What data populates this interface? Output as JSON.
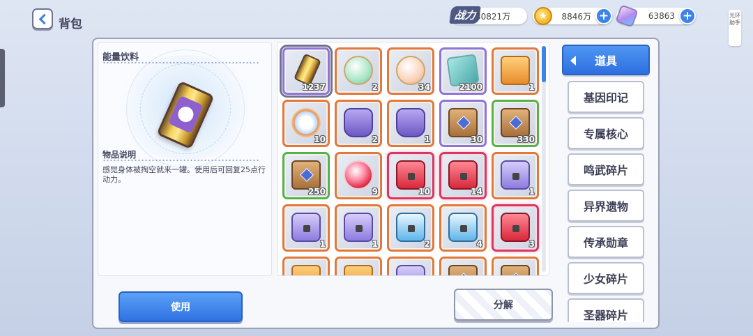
{
  "header": {
    "title": "背包",
    "helper_label": "光环助手"
  },
  "resources": {
    "power_label": "战力",
    "power_value": "30821万",
    "coins": "8846万",
    "gems": "63863"
  },
  "detail": {
    "item_name": "能量饮料",
    "desc_title": "物品说明",
    "desc_text": "感觉身体被掏空就来一罐。使用后可回复25点行动力。"
  },
  "grid": {
    "items": [
      {
        "count": "1237",
        "art": "can",
        "frame": "purple",
        "selected": true
      },
      {
        "count": "2",
        "art": "orb",
        "frame": "orange"
      },
      {
        "count": "34",
        "art": "orb2",
        "frame": "orange"
      },
      {
        "count": "2100",
        "art": "teal",
        "frame": "purple"
      },
      {
        "count": "1",
        "art": "box-gold",
        "frame": "orange"
      },
      {
        "count": "10",
        "art": "ring-orb",
        "frame": "orange"
      },
      {
        "count": "2",
        "art": "drum",
        "frame": "orange"
      },
      {
        "count": "1",
        "art": "drum",
        "frame": "orange"
      },
      {
        "count": "30",
        "art": "chest",
        "frame": "purple"
      },
      {
        "count": "330",
        "art": "chest",
        "frame": "green"
      },
      {
        "count": "250",
        "art": "chest",
        "frame": "green"
      },
      {
        "count": "9",
        "art": "redorb",
        "frame": "orange"
      },
      {
        "count": "10",
        "art": "box-red",
        "frame": "red"
      },
      {
        "count": "14",
        "art": "box-red",
        "frame": "red"
      },
      {
        "count": "1",
        "art": "box-purple",
        "frame": "orange"
      },
      {
        "count": "1",
        "art": "box-purple",
        "frame": "orange"
      },
      {
        "count": "1",
        "art": "box-purple",
        "frame": "orange"
      },
      {
        "count": "2",
        "art": "box-blue",
        "frame": "orange"
      },
      {
        "count": "4",
        "art": "box-blue",
        "frame": "orange"
      },
      {
        "count": "3",
        "art": "box-red",
        "frame": "red"
      },
      {
        "count": "",
        "art": "box-gold",
        "frame": "orange"
      },
      {
        "count": "",
        "art": "box-gold",
        "frame": "orange"
      },
      {
        "count": "",
        "art": "box-purple",
        "frame": "orange"
      },
      {
        "count": "",
        "art": "chest",
        "frame": "orange"
      },
      {
        "count": "",
        "art": "chest",
        "frame": "orange"
      }
    ]
  },
  "tabs": [
    {
      "label": "道具",
      "active": true
    },
    {
      "label": "基因印记"
    },
    {
      "label": "专属核心"
    },
    {
      "label": "鸣武碎片"
    },
    {
      "label": "异界遗物"
    },
    {
      "label": "传承勋章"
    },
    {
      "label": "少女碎片"
    },
    {
      "label": "圣器碎片"
    }
  ],
  "buttons": {
    "use": "使用",
    "split": "分解"
  }
}
